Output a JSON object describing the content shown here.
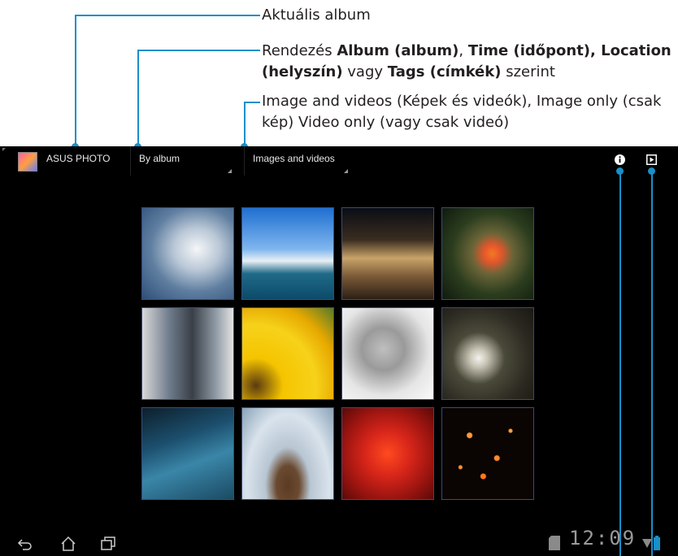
{
  "annotations": {
    "current_album": "Aktuális album",
    "sort": {
      "prefix": "Rendezés ",
      "b1": "Album (album)",
      "sep1": ", ",
      "b2": "Time (időpont), Location",
      "b3": "(helyszín)",
      "mid": " vagy ",
      "b4": "Tags (címkék)",
      "suffix": " szerint"
    },
    "filter_line1": "Image and videos (Képek és videók), Image only (csak",
    "filter_line2": "kép) Video only (vagy csak videó)"
  },
  "action_bar": {
    "app_title": "ASUS PHOTO",
    "sort_spinner": "By album",
    "filter_spinner": "Images and videos",
    "info_icon": "info-icon",
    "slideshow_icon": "play-icon"
  },
  "gallery": [
    {
      "name": "cloudy-sky"
    },
    {
      "name": "harbor-boat"
    },
    {
      "name": "night-building"
    },
    {
      "name": "clownfish"
    },
    {
      "name": "couple-walking"
    },
    {
      "name": "sunflower"
    },
    {
      "name": "sleeping-kitten"
    },
    {
      "name": "white-flower"
    },
    {
      "name": "blue-water"
    },
    {
      "name": "misty-rock"
    },
    {
      "name": "red-leaves"
    },
    {
      "name": "sky-lanterns"
    }
  ],
  "status_bar": {
    "clock": "12:09",
    "nav": [
      "back-icon",
      "home-icon",
      "recent-apps-icon"
    ]
  },
  "colors": {
    "callout": "#1a8fc8",
    "thumb_border": "#3b4a7c",
    "background": "#000000"
  }
}
